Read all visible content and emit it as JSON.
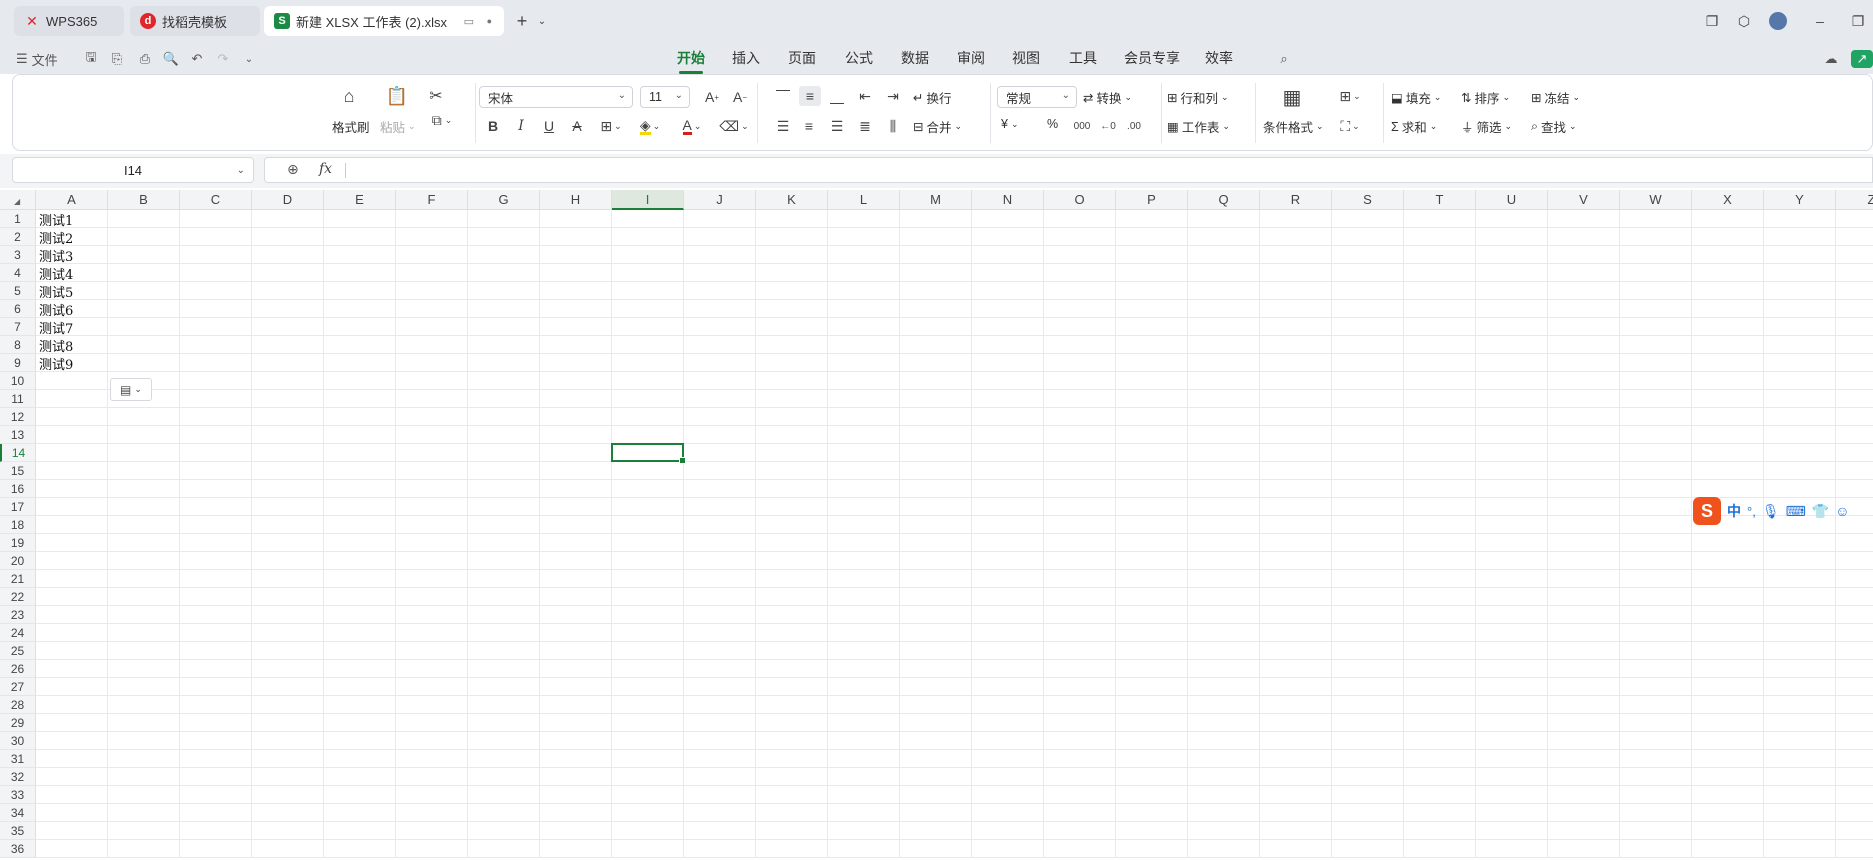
{
  "tabs": [
    {
      "label": "WPS365",
      "icon": "wps-logo-icon",
      "color": "#e0262a"
    },
    {
      "label": "找稻壳模板",
      "icon": "docer-icon",
      "color": "#e0262a"
    },
    {
      "label": "新建 XLSX 工作表 (2).xlsx",
      "icon": "sheet-s-icon",
      "icon_text": "S",
      "color": "#1b8a43"
    }
  ],
  "menu": {
    "file_label": "文件",
    "tabs": [
      "开始",
      "插入",
      "页面",
      "公式",
      "数据",
      "审阅",
      "视图",
      "工具",
      "会员专享",
      "效率"
    ],
    "active_tab": "开始"
  },
  "ribbon": {
    "format_painter": "格式刷",
    "paste": "粘贴",
    "font_name": "宋体",
    "font_size": "11",
    "wrap": "换行",
    "merge": "合并",
    "number_format": "常规",
    "convert": "转换",
    "row_col": "行和列",
    "worksheet": "工作表",
    "cond_format": "条件格式",
    "fill": "填充",
    "sort": "排序",
    "freeze": "冻结",
    "sum": "求和",
    "filter": "筛选",
    "find": "查找",
    "currency_symbol": "¥",
    "percent_symbol": "%"
  },
  "formula_bar": {
    "name_box": "I14",
    "fx": "fx",
    "value": ""
  },
  "columns": [
    "A",
    "B",
    "C",
    "D",
    "E",
    "F",
    "G",
    "H",
    "I",
    "J",
    "K",
    "L",
    "M",
    "N",
    "O",
    "P",
    "Q",
    "R",
    "S",
    "T",
    "U",
    "V",
    "W",
    "X",
    "Y",
    "Z"
  ],
  "rows": [
    "1",
    "2",
    "3",
    "4",
    "5",
    "6",
    "7",
    "8",
    "9",
    "10",
    "11",
    "12",
    "13",
    "14",
    "15",
    "16",
    "17",
    "18",
    "19",
    "20",
    "21",
    "22",
    "23",
    "24",
    "25",
    "26",
    "27",
    "28",
    "29",
    "30",
    "31",
    "32",
    "33",
    "34",
    "35",
    "36"
  ],
  "cells": [
    "测试1",
    "测试2",
    "测试3",
    "测试4",
    "测试5",
    "测试6",
    "测试7",
    "测试8",
    "测试9"
  ],
  "selected_cell": {
    "column": "I",
    "row": "14"
  },
  "ime": {
    "mode": "中",
    "punct": "°,"
  },
  "colors": {
    "accent": "#1b7f3a",
    "wps_red": "#e0262a",
    "sogou_orange": "#f0521e"
  }
}
